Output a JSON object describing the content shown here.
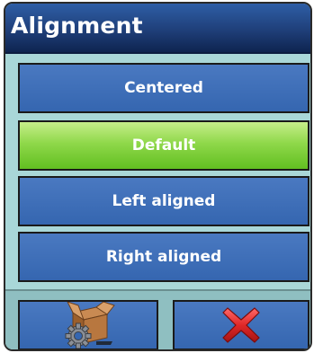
{
  "dialog": {
    "title": "Alignment"
  },
  "options": [
    {
      "label": "Centered",
      "selected": false
    },
    {
      "label": "Default",
      "selected": true
    },
    {
      "label": "Left aligned",
      "selected": false
    },
    {
      "label": "Right aligned",
      "selected": false
    }
  ],
  "footer": {
    "setup_icon": "box-gear-icon",
    "cancel_icon": "red-x-icon"
  },
  "colors": {
    "title_bar": "#1f3f79",
    "option_bg": "#3566b0",
    "selected_bg": "#8fd84a",
    "dialog_bg": "#a9d7d8",
    "cancel_x": "#d8262b"
  }
}
